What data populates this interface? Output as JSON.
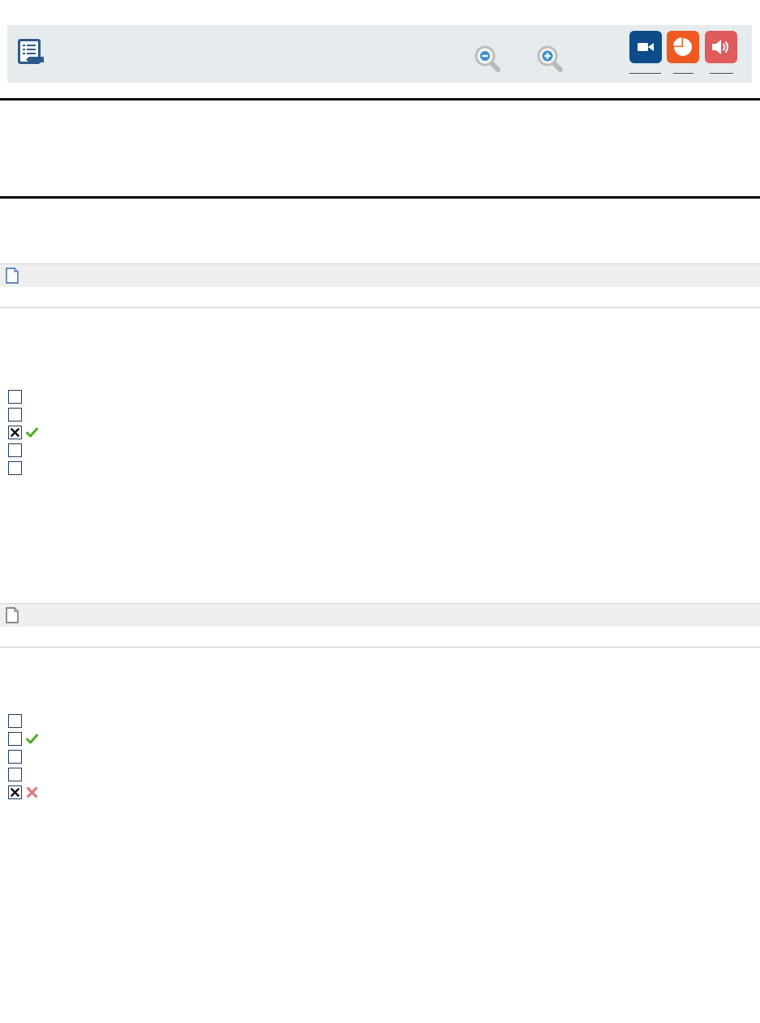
{
  "toolbar": {
    "icons": {
      "toc": "table-of-contents-icon",
      "zoom_out": "zoom-out-icon",
      "zoom_in": "zoom-in-icon",
      "video": "video-camera-icon",
      "chart": "pie-chart-icon",
      "audio": "speaker-icon"
    },
    "colors": {
      "toolbar_bg": "#e6ebee",
      "toc_icon": "#2e5a8a",
      "video": "#0d4c88",
      "chart": "#f05a22",
      "audio": "#e05b5b"
    }
  },
  "sections": [
    {
      "icon": "page-icon",
      "icon_color": "#2c66b5",
      "options": [
        {
          "checked": false,
          "feedback": "none"
        },
        {
          "checked": false,
          "feedback": "none"
        },
        {
          "checked": true,
          "feedback": "correct"
        },
        {
          "checked": false,
          "feedback": "none"
        },
        {
          "checked": false,
          "feedback": "none"
        }
      ]
    },
    {
      "icon": "page-icon",
      "icon_color": "#666666",
      "options": [
        {
          "checked": false,
          "feedback": "none"
        },
        {
          "checked": false,
          "feedback": "correct"
        },
        {
          "checked": false,
          "feedback": "none"
        },
        {
          "checked": false,
          "feedback": "none"
        },
        {
          "checked": true,
          "feedback": "incorrect"
        }
      ]
    }
  ],
  "feedback_colors": {
    "correct": "#4caf1e",
    "incorrect": "#e07a7a"
  }
}
